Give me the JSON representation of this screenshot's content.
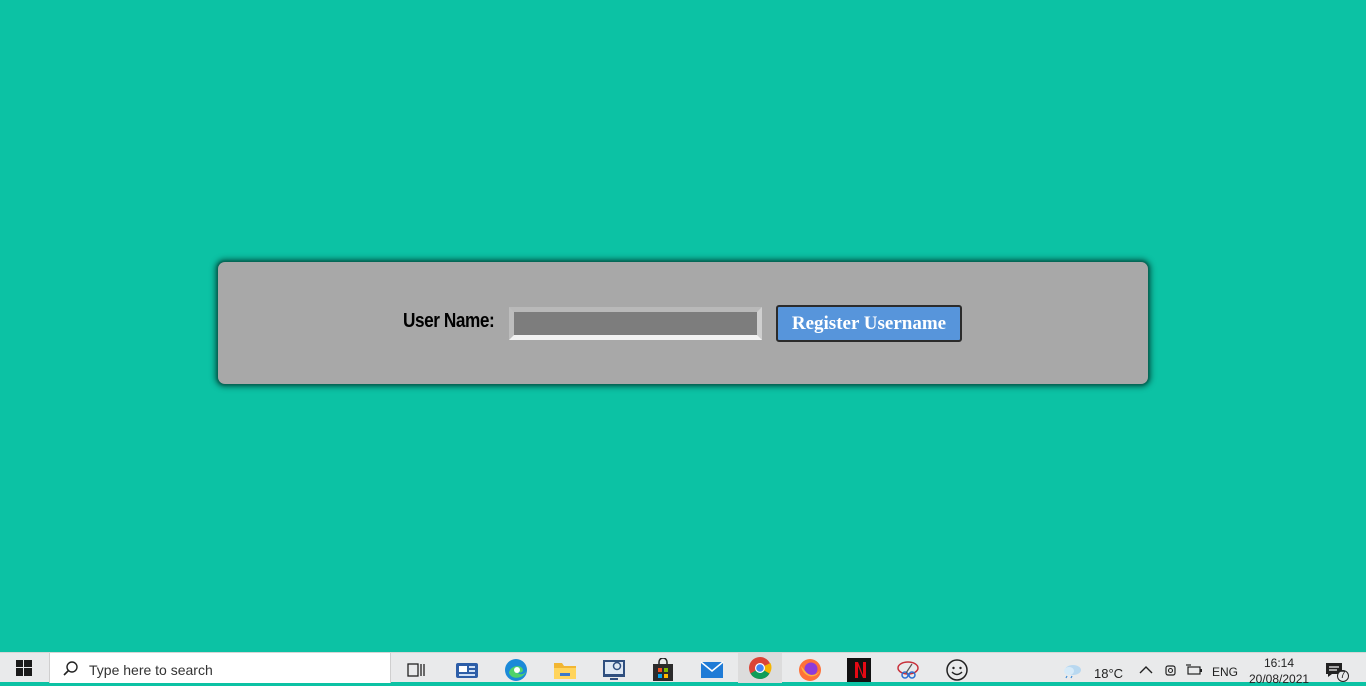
{
  "form": {
    "username_label": "User Name:",
    "username_value": "",
    "register_button_label": "Register Username"
  },
  "taskbar": {
    "search_placeholder": "Type here to search",
    "apps": [
      "task-view-icon",
      "news-app-icon",
      "edge-icon",
      "file-explorer-icon",
      "remote-desktop-icon",
      "microsoft-store-icon",
      "mail-icon",
      "chrome-icon",
      "firefox-icon",
      "netflix-icon",
      "snipping-tool-icon",
      "feedback-icon"
    ],
    "weather_temp": "18°C",
    "language": "ENG",
    "time": "16:14",
    "date": "20/08/2021",
    "notification_count": "7"
  },
  "colors": {
    "background": "#0cc2a4",
    "panel": "#a8a8a8",
    "input_fill": "#7d7d7d",
    "button": "#5795db"
  }
}
